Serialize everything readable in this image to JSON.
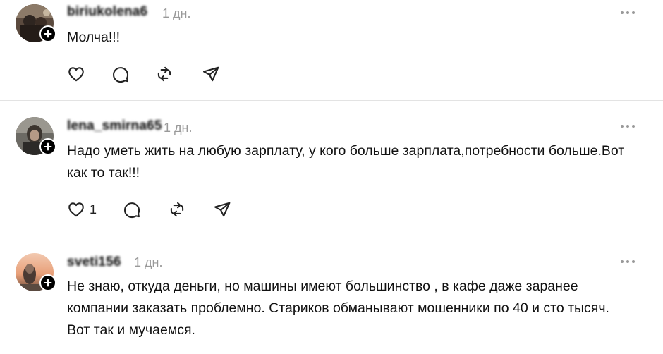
{
  "posts": [
    {
      "username": "biriukolena6",
      "time": "1 дн.",
      "text": "Молча!!!",
      "likes": ""
    },
    {
      "username": "lena_smirna65",
      "time": "1 дн.",
      "text": "Надо уметь жить на любую зарплату, у кого больше зарплата,потребности больше.Вот как то так!!!",
      "likes": "1"
    },
    {
      "username": "sveti156",
      "time": "1 дн.",
      "text": "Не знаю, откуда деньги, но машины имеют большинство , в кафе даже заранее компании заказать проблемно. Стариков обманывают мошенники по 40 и сто тысяч. Вот так и мучаемся.",
      "likes": ""
    }
  ],
  "icons": {
    "like": "heart-icon",
    "reply": "comment-icon",
    "repost": "repost-icon",
    "share": "send-icon",
    "more": "more-dots-icon",
    "follow": "plus-icon"
  },
  "colors": {
    "text": "#111111",
    "meta": "#999999",
    "divider": "#e3e3e3",
    "badge": "#000000"
  }
}
